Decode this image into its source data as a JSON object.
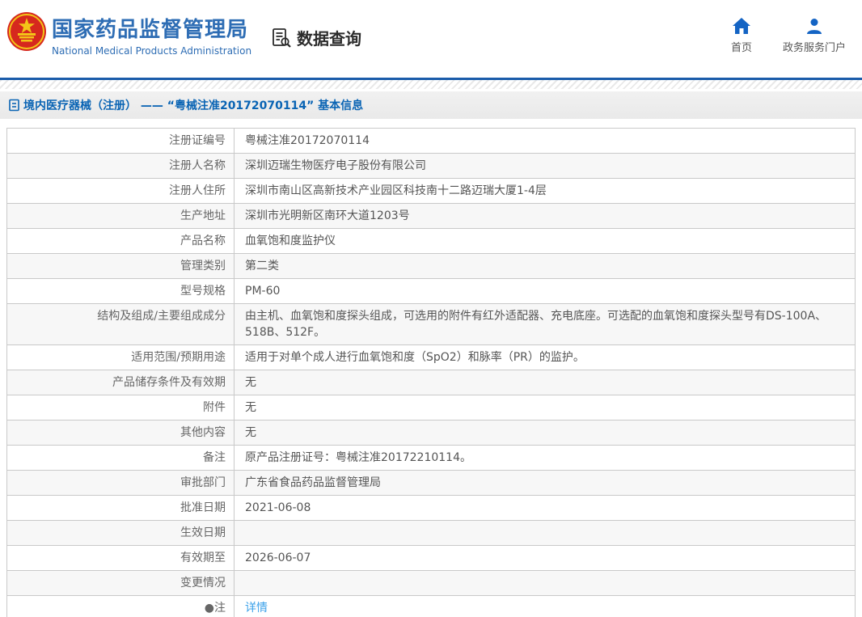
{
  "header": {
    "title": "国家药品监督管理局",
    "subtitle": "National Medical Products Administration",
    "section": "数据查询",
    "nav": [
      {
        "label": "首页",
        "icon": "home-icon"
      },
      {
        "label": "政务服务门户",
        "icon": "user-icon"
      }
    ]
  },
  "breadcrumb": {
    "text": "境内医疗器械（注册） —— “粤械注准20172070114” 基本信息"
  },
  "table": {
    "rows": [
      {
        "label": "注册证编号",
        "value": "粤械注准20172070114"
      },
      {
        "label": "注册人名称",
        "value": "深圳迈瑞生物医疗电子股份有限公司"
      },
      {
        "label": "注册人住所",
        "value": "深圳市南山区高新技术产业园区科技南十二路迈瑞大厦1-4层"
      },
      {
        "label": "生产地址",
        "value": "深圳市光明新区南环大道1203号"
      },
      {
        "label": "产品名称",
        "value": "血氧饱和度监护仪"
      },
      {
        "label": "管理类别",
        "value": "第二类"
      },
      {
        "label": "型号规格",
        "value": "PM-60"
      },
      {
        "label": "结构及组成/主要组成成分",
        "value": "由主机、血氧饱和度探头组成，可选用的附件有红外适配器、充电底座。可选配的血氧饱和度探头型号有DS-100A、518B、512F。"
      },
      {
        "label": "适用范围/预期用途",
        "value": "适用于对单个成人进行血氧饱和度（SpO2）和脉率（PR）的监护。"
      },
      {
        "label": "产品储存条件及有效期",
        "value": "无"
      },
      {
        "label": "附件",
        "value": "无"
      },
      {
        "label": "其他内容",
        "value": "无"
      },
      {
        "label": "备注",
        "value": "原产品注册证号：粤械注准20172210114。"
      },
      {
        "label": "审批部门",
        "value": "广东省食品药品监督管理局"
      },
      {
        "label": "批准日期",
        "value": "2021-06-08"
      },
      {
        "label": "生效日期",
        "value": ""
      },
      {
        "label": "有效期至",
        "value": "2026-06-07"
      },
      {
        "label": "变更情况",
        "value": ""
      },
      {
        "label": "●注",
        "value": "详情",
        "link": true
      }
    ]
  },
  "colors": {
    "brand_blue": "#2e6db4",
    "icon_blue": "#1464c4",
    "breadcrumb_blue": "#0a64b4",
    "link_blue": "#3aa0e9",
    "separator_blue": "#1b5caa",
    "row_alt_gray": "#f7f7f7",
    "border_gray": "#c9c9c9"
  }
}
